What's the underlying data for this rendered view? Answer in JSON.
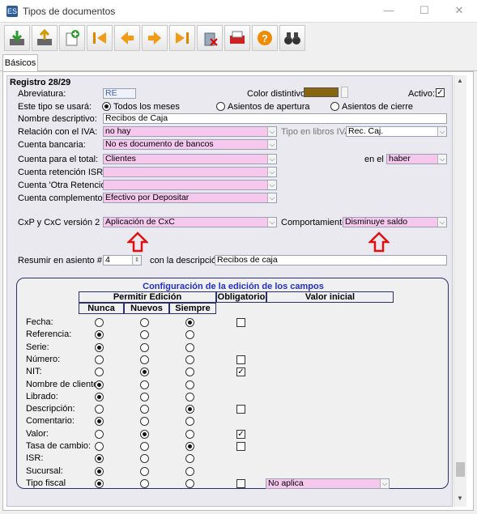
{
  "window": {
    "title": "Tipos de documentos",
    "app_icon": "ES"
  },
  "toolbar": {
    "icons": [
      "save-icon",
      "export-icon",
      "new-document-icon",
      "first-record-icon",
      "previous-record-icon",
      "next-record-icon",
      "last-record-icon",
      "delete-icon",
      "print-icon",
      "help-icon",
      "search-binoculars-icon"
    ]
  },
  "tabs": [
    "Básicos"
  ],
  "form": {
    "record": "Registro 28/29",
    "abrev_label": "Abreviatura:",
    "abrev_value": "RE",
    "color_label": "Color distintivo:",
    "color_value": "#8a6510",
    "activo_label": "Activo:",
    "uso_label": "Este tipo se usará:",
    "uso_options": [
      "Todos los meses",
      "Asientos de apertura",
      "Asientos de cierre"
    ],
    "nombre_label": "Nombre descriptivo:",
    "nombre_value": "Recibos de Caja",
    "iva_label": "Relación con el IVA:",
    "iva_value": "no hay",
    "tipo_libros_label": "Tipo en libros IVA:",
    "tipo_libros_value": "Rec. Caj.",
    "banco_label": "Cuenta bancaria:",
    "banco_value": "No es documento de bancos",
    "total_label": "Cuenta para el total:",
    "total_value": "Clientes",
    "enel_label": "en el",
    "enel_value": "haber",
    "isr_label": "Cuenta retención ISR:",
    "isr_value": "",
    "otra_label": "Cuenta 'Otra Retención':",
    "otra_value": "",
    "complemento_label": "Cuenta complemento:",
    "complemento_value": "Efectivo por Depositar",
    "cxp_label": "CxP y CxC versión 2 :",
    "cxp_value": "Aplicación de CxC",
    "comp_label": "Comportamiento:",
    "comp_value": "Disminuye saldo",
    "resumir_label": "Resumir en asiento #:",
    "resumir_value": "4",
    "desc_label": "con la descripción",
    "desc_value": "Recibos de caja"
  },
  "config": {
    "title": "Configuración de la edición de los campos",
    "permitir": "Permitir Edición",
    "obligatorio": "Obligatorio",
    "valor_inicial": "Valor inicial",
    "cols": [
      "Nunca",
      "Nuevos",
      "Siempre"
    ],
    "rows": [
      {
        "label": "Fecha:",
        "sel": 2,
        "check": false,
        "hasCheck": true
      },
      {
        "label": "Referencia:",
        "sel": 0,
        "check": false,
        "hasCheck": false
      },
      {
        "label": "Serie:",
        "sel": 0,
        "check": false,
        "hasCheck": false
      },
      {
        "label": "Número:",
        "sel": -1,
        "check": false,
        "hasCheck": true
      },
      {
        "label": "NIT:",
        "sel": 1,
        "check": true,
        "hasCheck": true
      },
      {
        "label": "Nombre de cliente:",
        "sel": 0,
        "check": false,
        "hasCheck": false
      },
      {
        "label": "Librado:",
        "sel": 0,
        "check": false,
        "hasCheck": false
      },
      {
        "label": "Descripción:",
        "sel": 2,
        "check": false,
        "hasCheck": true
      },
      {
        "label": "Comentario:",
        "sel": 0,
        "check": false,
        "hasCheck": false
      },
      {
        "label": "Valor:",
        "sel": 1,
        "check": true,
        "hasCheck": true
      },
      {
        "label": "Tasa de cambio:",
        "sel": 2,
        "check": false,
        "hasCheck": true
      },
      {
        "label": "ISR:",
        "sel": 0,
        "check": false,
        "hasCheck": false
      },
      {
        "label": "Sucursal:",
        "sel": 0,
        "check": false,
        "hasCheck": false
      },
      {
        "label": "Tipo fiscal",
        "sel": 0,
        "check": false,
        "hasCheck": true
      }
    ],
    "tipo_fiscal_value": "No aplica"
  }
}
